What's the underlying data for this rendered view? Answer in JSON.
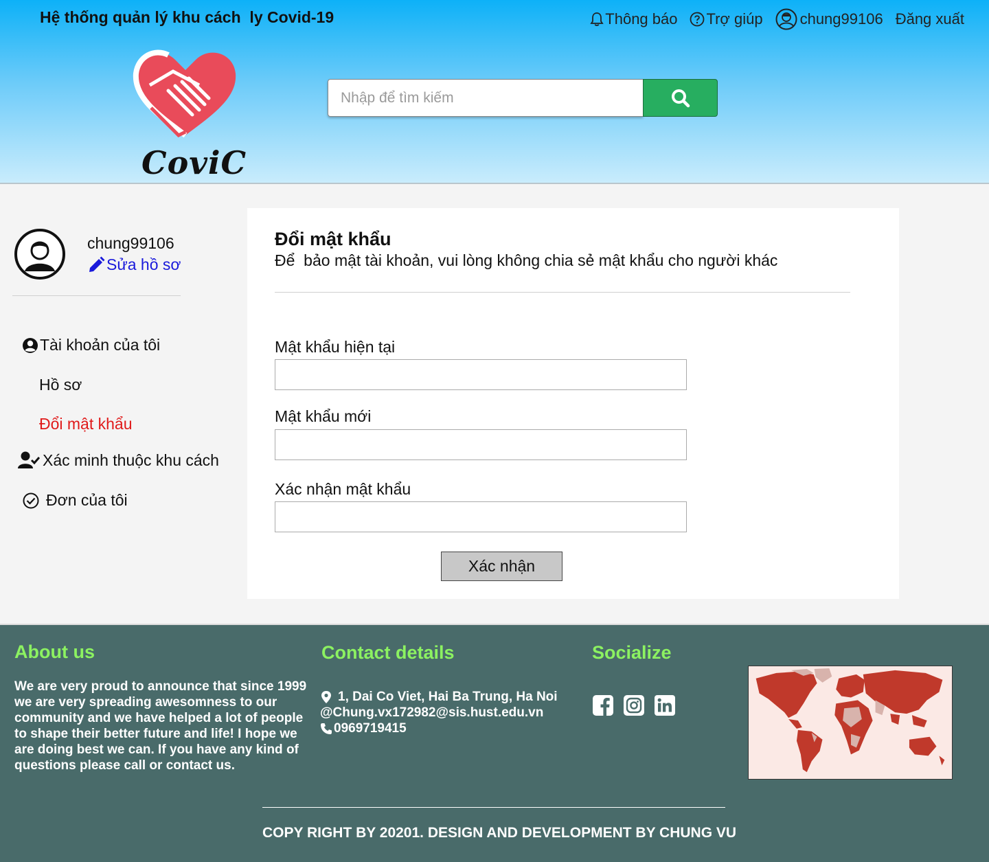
{
  "header": {
    "site_title": "Hệ thống quản lý khu cách  ly Covid-19",
    "logo_text": "CoviC",
    "nav": {
      "notifications": "Thông báo",
      "help": "Trợ giúp",
      "username": "chung99106",
      "logout": "Đăng xuất"
    },
    "search": {
      "placeholder": "Nhập để tìm kiếm"
    }
  },
  "sidebar": {
    "username": "chung99106",
    "edit_profile": "Sửa hồ sơ",
    "items": [
      {
        "label": "Tài khoản của tôi"
      },
      {
        "label": "Hồ sơ"
      },
      {
        "label": "Đổi mật khẩu"
      },
      {
        "label": "Xác minh thuộc khu cách"
      },
      {
        "label": "Đơn của tôi"
      }
    ]
  },
  "main": {
    "title": "Đổi mật khẩu",
    "subtitle": "Để  bảo mật tài khoản, vui lòng không chia sẻ mật khẩu cho người khác",
    "fields": [
      {
        "label": "Mật khẩu hiện tại",
        "value": ""
      },
      {
        "label": "Mật khẩu mới",
        "value": ""
      },
      {
        "label": "Xác nhận mật khẩu",
        "value": ""
      }
    ],
    "submit_label": "Xác nhận"
  },
  "footer": {
    "about_heading": "About us",
    "about_text": "We are very proud to announce that since 1999 we are very spreading awesomness to our community and we have helped a lot of people to shape their better future and life! I hope we are doing best we can. If you have any kind of questions please call or contact us.",
    "contact_heading": "Contact details",
    "address": "1, Dai Co Viet, Hai Ba Trung, Ha Noi",
    "email": "Chung.vx172982@sis.hust.edu.vn",
    "phone": "0969719415",
    "social_heading": "Socialize",
    "copyright": "COPY RIGHT BY 20201. DESIGN AND DEVELOPMENT BY CHUNG VU"
  },
  "colors": {
    "active_menu": "#e01a1a",
    "edit_link": "#1a1adb",
    "search_button": "#27ae60",
    "footer_bg": "#496b6a",
    "footer_heading": "#8cf261",
    "logo_heart": "#e94b5a"
  }
}
